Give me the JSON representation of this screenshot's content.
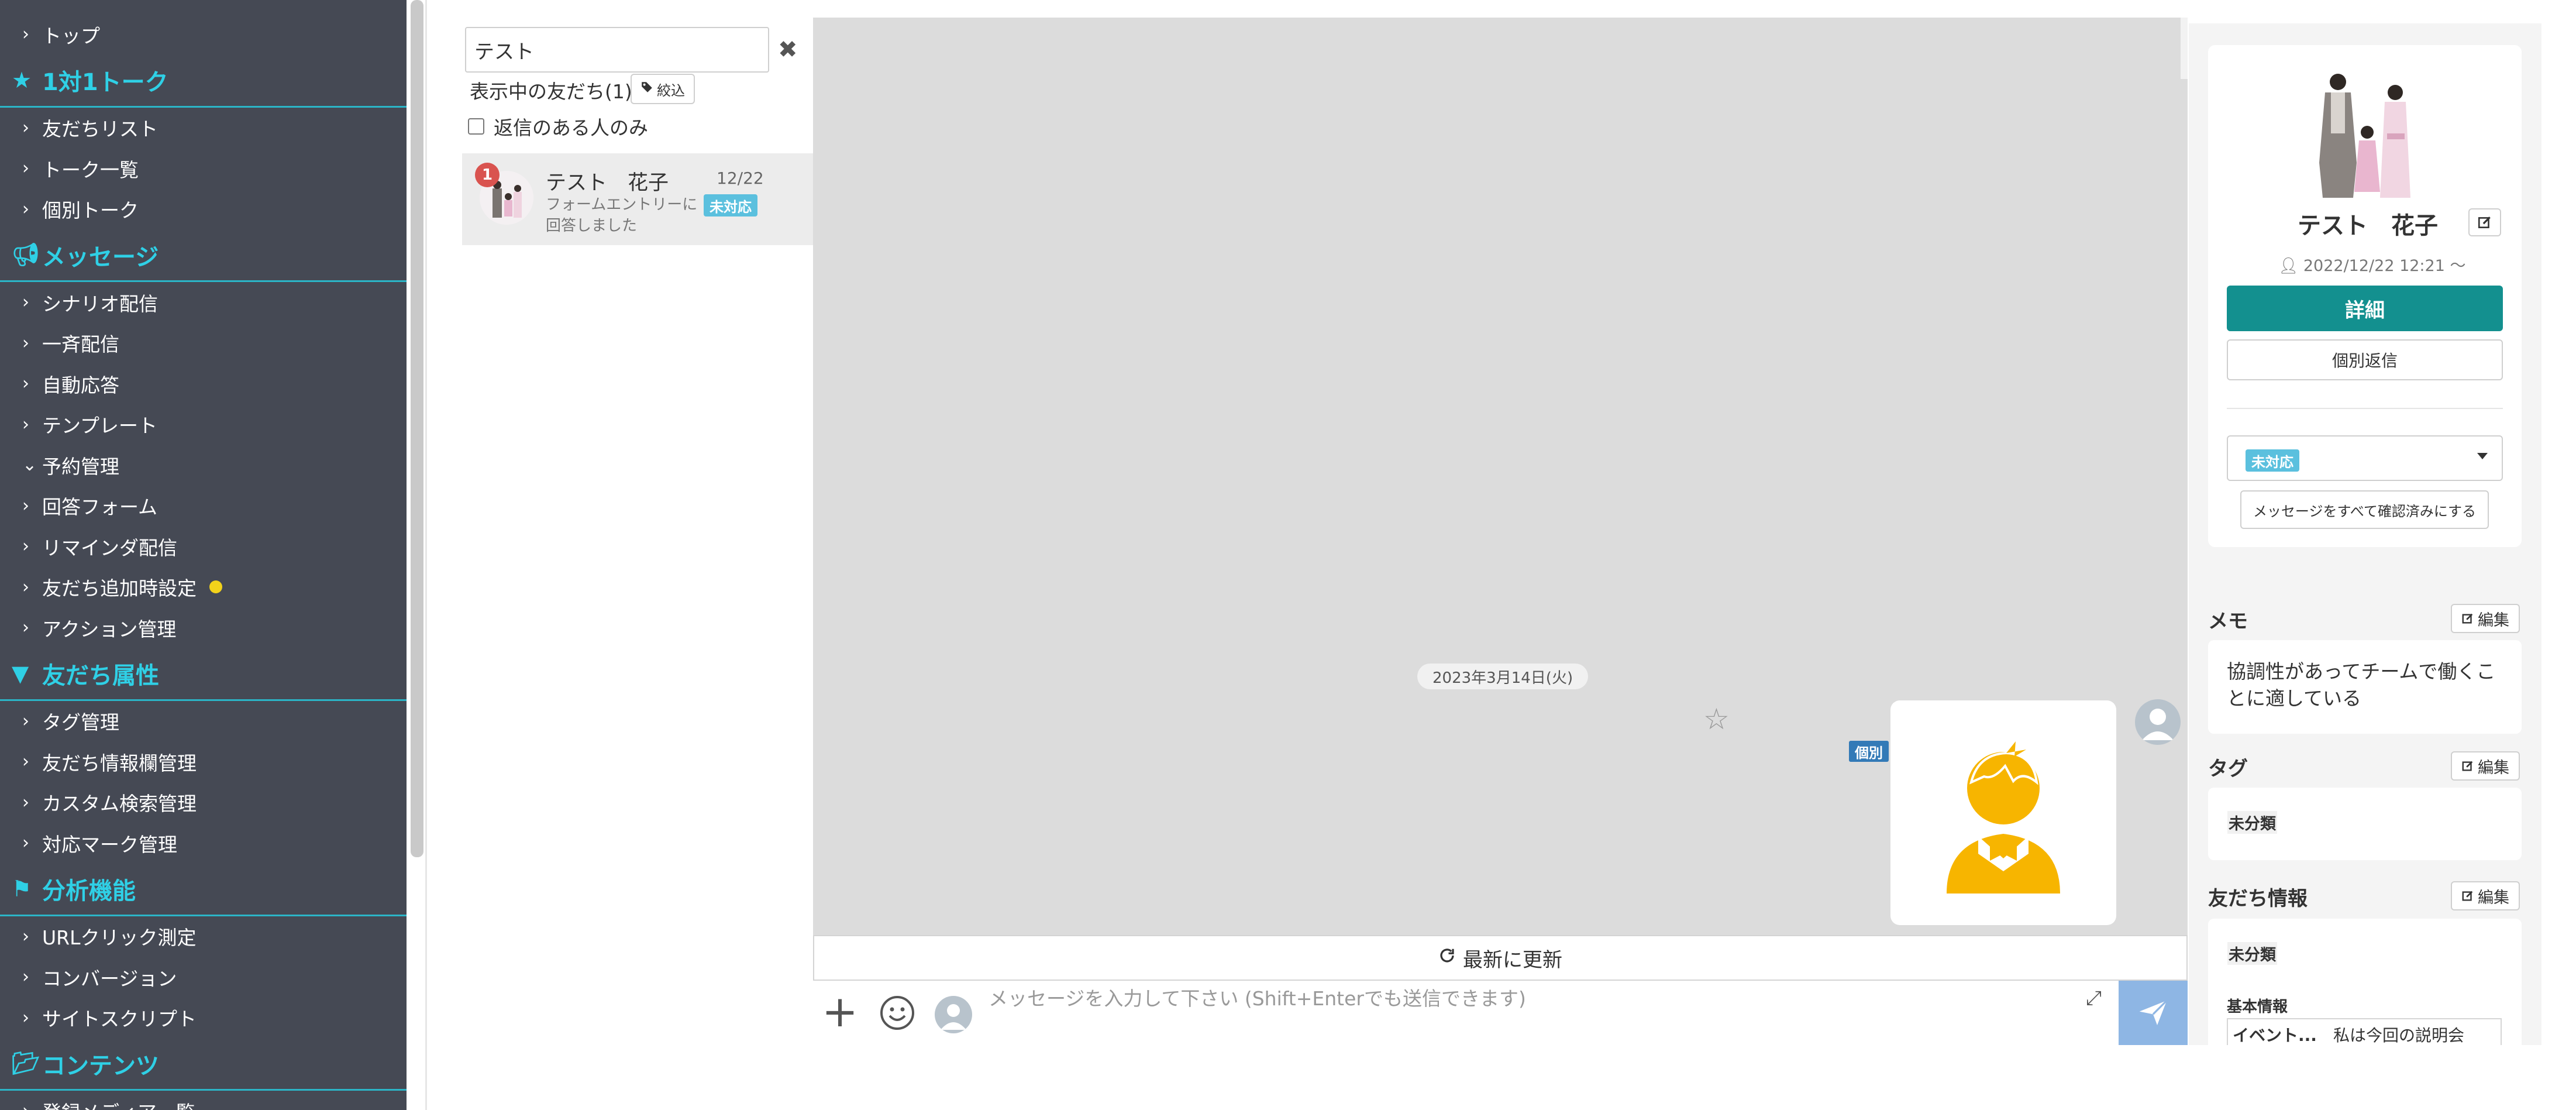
{
  "sidebar": {
    "items": [
      {
        "type": "item",
        "label": "トップ",
        "chevron": "right"
      },
      {
        "type": "section",
        "label": "1対1トーク",
        "icon": "star-icon"
      },
      {
        "type": "item",
        "label": "友だちリスト",
        "chevron": "right"
      },
      {
        "type": "item",
        "label": "トーク一覧",
        "chevron": "right"
      },
      {
        "type": "item",
        "label": "個別トーク",
        "chevron": "right"
      },
      {
        "type": "section",
        "label": "メッセージ",
        "icon": "megaphone-icon"
      },
      {
        "type": "item",
        "label": "シナリオ配信",
        "chevron": "right"
      },
      {
        "type": "item",
        "label": "一斉配信",
        "chevron": "right"
      },
      {
        "type": "item",
        "label": "自動応答",
        "chevron": "right"
      },
      {
        "type": "item",
        "label": "テンプレート",
        "chevron": "right"
      },
      {
        "type": "item",
        "label": "予約管理",
        "chevron": "down"
      },
      {
        "type": "item",
        "label": "回答フォーム",
        "chevron": "right"
      },
      {
        "type": "item",
        "label": "リマインダ配信",
        "chevron": "right"
      },
      {
        "type": "item",
        "label": "友だち追加時設定",
        "chevron": "right",
        "dot": true
      },
      {
        "type": "item",
        "label": "アクション管理",
        "chevron": "right"
      },
      {
        "type": "section",
        "label": "友だち属性",
        "icon": "filter-icon"
      },
      {
        "type": "item",
        "label": "タグ管理",
        "chevron": "right"
      },
      {
        "type": "item",
        "label": "友だち情報欄管理",
        "chevron": "right"
      },
      {
        "type": "item",
        "label": "カスタム検索管理",
        "chevron": "right"
      },
      {
        "type": "item",
        "label": "対応マーク管理",
        "chevron": "right"
      },
      {
        "type": "section",
        "label": "分析機能",
        "icon": "flag-icon"
      },
      {
        "type": "item",
        "label": "URLクリック測定",
        "chevron": "right"
      },
      {
        "type": "item",
        "label": "コンバージョン",
        "chevron": "right"
      },
      {
        "type": "item",
        "label": "サイトスクリプト",
        "chevron": "right"
      },
      {
        "type": "section",
        "label": "コンテンツ",
        "icon": "folder-icon"
      },
      {
        "type": "item",
        "label": "登録メディア一覧",
        "chevron": "right"
      }
    ]
  },
  "friend_list": {
    "search_value": "テスト",
    "count_label": "表示中の友だち(1)",
    "filter_label": "絞込",
    "reply_only_label": "返信のある人のみ",
    "friends": [
      {
        "name": "テスト　花子",
        "date": "12/22",
        "preview": "フォームエントリーに回答しました",
        "status": "未対応",
        "unread": "1"
      }
    ]
  },
  "chat": {
    "date_label": "2023年3月14日(火)",
    "badge_label": "個別",
    "refresh_label": "最新に更新",
    "input_placeholder": "メッセージを入力して下さい (Shift+Enterでも送信できます)"
  },
  "profile": {
    "name": "テスト　花子",
    "since": "2022/12/22 12:21 〜",
    "detail_label": "詳細",
    "reply_label": "個別返信",
    "status": "未対応",
    "confirm_all_label": "メッセージをすべて確認済みにする"
  },
  "memo": {
    "title": "メモ",
    "edit_label": "編集",
    "text": "協調性があってチームで働くことに適している"
  },
  "tags": {
    "title": "タグ",
    "edit_label": "編集",
    "value": "未分類"
  },
  "friend_info": {
    "title": "友だち情報",
    "edit_label": "編集",
    "value": "未分類",
    "basic_label": "基本情報",
    "basic_key": "イベント...",
    "basic_value": "私は今回の説明会"
  },
  "colors": {
    "sidebar_bg": "#454954",
    "accent_cyan": "#2fd0e6",
    "teal_button": "#13908f",
    "status_blue": "#5bc0de",
    "unread_red": "#d9534f"
  }
}
